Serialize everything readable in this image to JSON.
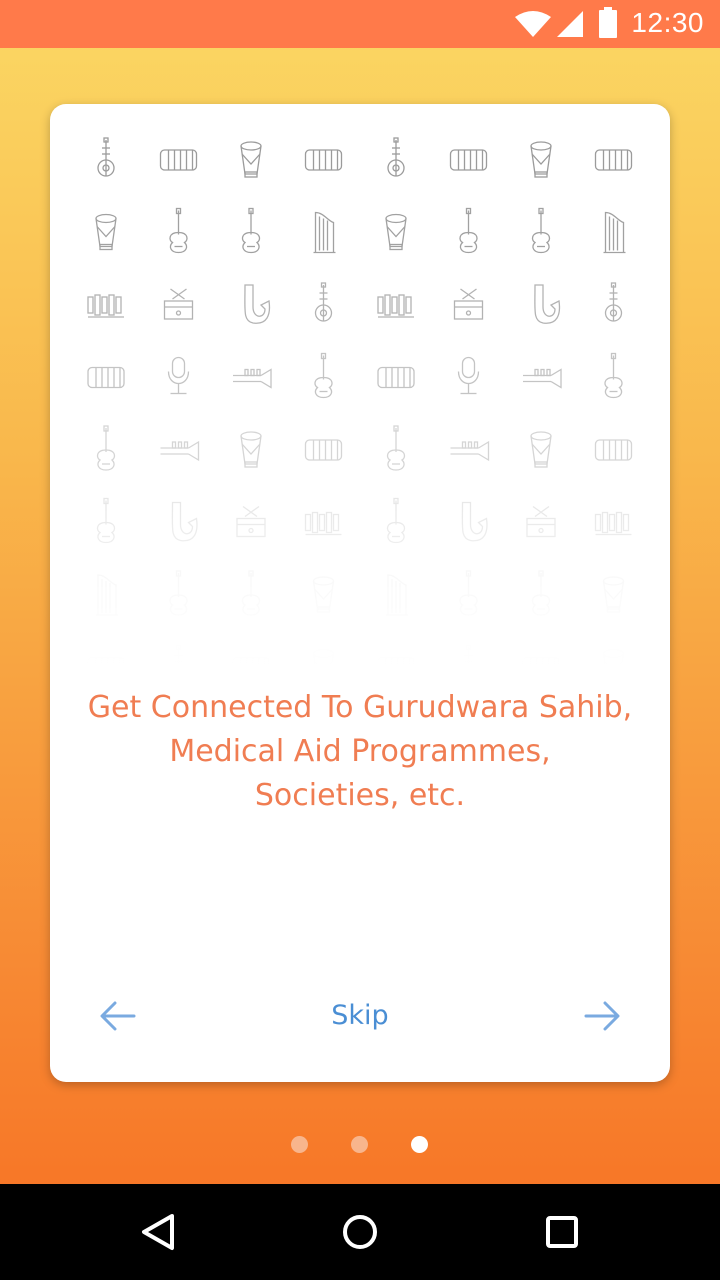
{
  "status_bar": {
    "time": "12:30",
    "icons": [
      "wifi-icon",
      "signal-icon",
      "battery-icon"
    ],
    "background": "#ff7a4a"
  },
  "card": {
    "pattern_icons": [
      "sitar-icon",
      "accordion-icon",
      "drum-icon",
      "guitar-icon",
      "harp-icon",
      "xylophone-icon",
      "snare-drum-icon",
      "saxophone-icon",
      "microphone-icon",
      "trumpet-icon"
    ],
    "message_lines": [
      "Get Connected To Gurudwara Sahib,",
      "Medical Aid Programmes,",
      "Societies, etc."
    ],
    "message_color": "#f07d52",
    "prev_icon": "arrow-left-icon",
    "next_icon": "arrow-right-icon",
    "skip_label": "Skip",
    "accent_color": "#4a8ed4"
  },
  "pager": {
    "count": 3,
    "active_index": 2
  },
  "nav_bar": {
    "buttons": [
      "back-icon",
      "home-icon",
      "recents-icon"
    ]
  }
}
